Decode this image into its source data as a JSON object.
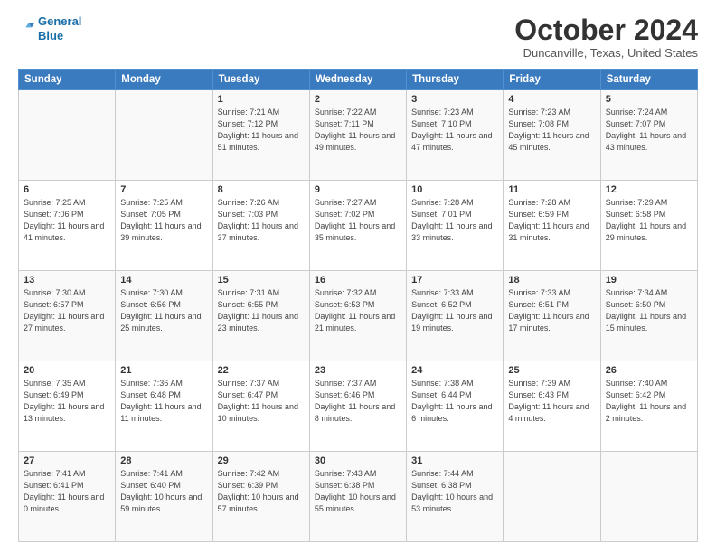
{
  "logo": {
    "line1": "General",
    "line2": "Blue"
  },
  "title": "October 2024",
  "location": "Duncanville, Texas, United States",
  "weekdays": [
    "Sunday",
    "Monday",
    "Tuesday",
    "Wednesday",
    "Thursday",
    "Friday",
    "Saturday"
  ],
  "weeks": [
    [
      {
        "day": "",
        "sunrise": "",
        "sunset": "",
        "daylight": ""
      },
      {
        "day": "",
        "sunrise": "",
        "sunset": "",
        "daylight": ""
      },
      {
        "day": "1",
        "sunrise": "Sunrise: 7:21 AM",
        "sunset": "Sunset: 7:12 PM",
        "daylight": "Daylight: 11 hours and 51 minutes."
      },
      {
        "day": "2",
        "sunrise": "Sunrise: 7:22 AM",
        "sunset": "Sunset: 7:11 PM",
        "daylight": "Daylight: 11 hours and 49 minutes."
      },
      {
        "day": "3",
        "sunrise": "Sunrise: 7:23 AM",
        "sunset": "Sunset: 7:10 PM",
        "daylight": "Daylight: 11 hours and 47 minutes."
      },
      {
        "day": "4",
        "sunrise": "Sunrise: 7:23 AM",
        "sunset": "Sunset: 7:08 PM",
        "daylight": "Daylight: 11 hours and 45 minutes."
      },
      {
        "day": "5",
        "sunrise": "Sunrise: 7:24 AM",
        "sunset": "Sunset: 7:07 PM",
        "daylight": "Daylight: 11 hours and 43 minutes."
      }
    ],
    [
      {
        "day": "6",
        "sunrise": "Sunrise: 7:25 AM",
        "sunset": "Sunset: 7:06 PM",
        "daylight": "Daylight: 11 hours and 41 minutes."
      },
      {
        "day": "7",
        "sunrise": "Sunrise: 7:25 AM",
        "sunset": "Sunset: 7:05 PM",
        "daylight": "Daylight: 11 hours and 39 minutes."
      },
      {
        "day": "8",
        "sunrise": "Sunrise: 7:26 AM",
        "sunset": "Sunset: 7:03 PM",
        "daylight": "Daylight: 11 hours and 37 minutes."
      },
      {
        "day": "9",
        "sunrise": "Sunrise: 7:27 AM",
        "sunset": "Sunset: 7:02 PM",
        "daylight": "Daylight: 11 hours and 35 minutes."
      },
      {
        "day": "10",
        "sunrise": "Sunrise: 7:28 AM",
        "sunset": "Sunset: 7:01 PM",
        "daylight": "Daylight: 11 hours and 33 minutes."
      },
      {
        "day": "11",
        "sunrise": "Sunrise: 7:28 AM",
        "sunset": "Sunset: 6:59 PM",
        "daylight": "Daylight: 11 hours and 31 minutes."
      },
      {
        "day": "12",
        "sunrise": "Sunrise: 7:29 AM",
        "sunset": "Sunset: 6:58 PM",
        "daylight": "Daylight: 11 hours and 29 minutes."
      }
    ],
    [
      {
        "day": "13",
        "sunrise": "Sunrise: 7:30 AM",
        "sunset": "Sunset: 6:57 PM",
        "daylight": "Daylight: 11 hours and 27 minutes."
      },
      {
        "day": "14",
        "sunrise": "Sunrise: 7:30 AM",
        "sunset": "Sunset: 6:56 PM",
        "daylight": "Daylight: 11 hours and 25 minutes."
      },
      {
        "day": "15",
        "sunrise": "Sunrise: 7:31 AM",
        "sunset": "Sunset: 6:55 PM",
        "daylight": "Daylight: 11 hours and 23 minutes."
      },
      {
        "day": "16",
        "sunrise": "Sunrise: 7:32 AM",
        "sunset": "Sunset: 6:53 PM",
        "daylight": "Daylight: 11 hours and 21 minutes."
      },
      {
        "day": "17",
        "sunrise": "Sunrise: 7:33 AM",
        "sunset": "Sunset: 6:52 PM",
        "daylight": "Daylight: 11 hours and 19 minutes."
      },
      {
        "day": "18",
        "sunrise": "Sunrise: 7:33 AM",
        "sunset": "Sunset: 6:51 PM",
        "daylight": "Daylight: 11 hours and 17 minutes."
      },
      {
        "day": "19",
        "sunrise": "Sunrise: 7:34 AM",
        "sunset": "Sunset: 6:50 PM",
        "daylight": "Daylight: 11 hours and 15 minutes."
      }
    ],
    [
      {
        "day": "20",
        "sunrise": "Sunrise: 7:35 AM",
        "sunset": "Sunset: 6:49 PM",
        "daylight": "Daylight: 11 hours and 13 minutes."
      },
      {
        "day": "21",
        "sunrise": "Sunrise: 7:36 AM",
        "sunset": "Sunset: 6:48 PM",
        "daylight": "Daylight: 11 hours and 11 minutes."
      },
      {
        "day": "22",
        "sunrise": "Sunrise: 7:37 AM",
        "sunset": "Sunset: 6:47 PM",
        "daylight": "Daylight: 11 hours and 10 minutes."
      },
      {
        "day": "23",
        "sunrise": "Sunrise: 7:37 AM",
        "sunset": "Sunset: 6:46 PM",
        "daylight": "Daylight: 11 hours and 8 minutes."
      },
      {
        "day": "24",
        "sunrise": "Sunrise: 7:38 AM",
        "sunset": "Sunset: 6:44 PM",
        "daylight": "Daylight: 11 hours and 6 minutes."
      },
      {
        "day": "25",
        "sunrise": "Sunrise: 7:39 AM",
        "sunset": "Sunset: 6:43 PM",
        "daylight": "Daylight: 11 hours and 4 minutes."
      },
      {
        "day": "26",
        "sunrise": "Sunrise: 7:40 AM",
        "sunset": "Sunset: 6:42 PM",
        "daylight": "Daylight: 11 hours and 2 minutes."
      }
    ],
    [
      {
        "day": "27",
        "sunrise": "Sunrise: 7:41 AM",
        "sunset": "Sunset: 6:41 PM",
        "daylight": "Daylight: 11 hours and 0 minutes."
      },
      {
        "day": "28",
        "sunrise": "Sunrise: 7:41 AM",
        "sunset": "Sunset: 6:40 PM",
        "daylight": "Daylight: 10 hours and 59 minutes."
      },
      {
        "day": "29",
        "sunrise": "Sunrise: 7:42 AM",
        "sunset": "Sunset: 6:39 PM",
        "daylight": "Daylight: 10 hours and 57 minutes."
      },
      {
        "day": "30",
        "sunrise": "Sunrise: 7:43 AM",
        "sunset": "Sunset: 6:38 PM",
        "daylight": "Daylight: 10 hours and 55 minutes."
      },
      {
        "day": "31",
        "sunrise": "Sunrise: 7:44 AM",
        "sunset": "Sunset: 6:38 PM",
        "daylight": "Daylight: 10 hours and 53 minutes."
      },
      {
        "day": "",
        "sunrise": "",
        "sunset": "",
        "daylight": ""
      },
      {
        "day": "",
        "sunrise": "",
        "sunset": "",
        "daylight": ""
      }
    ]
  ]
}
